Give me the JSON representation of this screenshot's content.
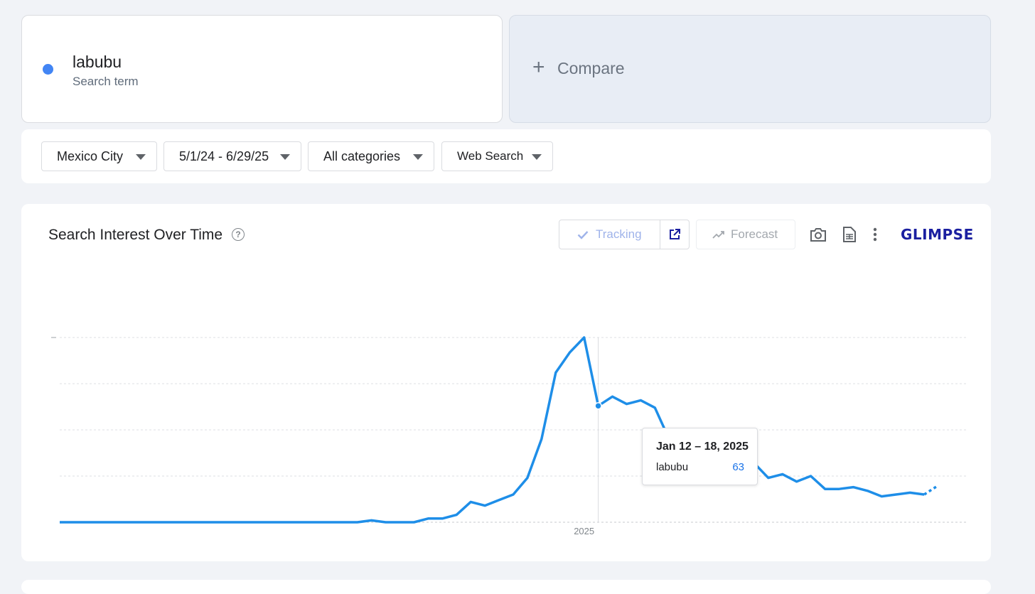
{
  "term": {
    "name": "labubu",
    "type": "Search term",
    "color": "#4285f4"
  },
  "compare": {
    "plus": "+",
    "label": "Compare"
  },
  "filters": [
    {
      "label": "Mexico City"
    },
    {
      "label": "5/1/24 - 6/29/25"
    },
    {
      "label": "All categories"
    },
    {
      "label": "Web Search"
    }
  ],
  "chart_section": {
    "title": "Search Interest Over Time",
    "help": "?",
    "tracking_label": "Tracking",
    "forecast_label": "Forecast",
    "logo": "GLIMPSE",
    "icons": [
      "check-icon",
      "external-link-icon",
      "trend-icon",
      "camera-icon",
      "document-icon",
      "more-vert-icon"
    ]
  },
  "chart_data": {
    "type": "line",
    "title": "",
    "xlabel": "",
    "ylabel": "",
    "x_tick_labels": [
      "2025"
    ],
    "ylim": [
      0,
      100
    ],
    "grid": true,
    "series": [
      {
        "name": "labubu",
        "color": "#1e8ee8",
        "values": [
          0,
          0,
          0,
          0,
          0,
          0,
          0,
          0,
          0,
          0,
          0,
          0,
          0,
          0,
          0,
          0,
          0,
          0,
          0,
          0,
          0,
          0,
          1,
          0,
          0,
          0,
          2,
          2,
          4,
          11,
          9,
          12,
          15,
          24,
          45,
          81,
          92,
          100,
          63,
          68,
          64,
          66,
          62,
          45,
          38,
          33,
          30,
          28,
          29,
          32,
          24,
          26,
          22,
          25,
          18,
          18,
          19,
          17,
          14,
          15,
          16,
          15
        ],
        "partial_values": [
          15,
          20
        ]
      }
    ],
    "tooltip": {
      "date": "Jan 12 – 18, 2025",
      "term": "labubu",
      "value": "63"
    }
  }
}
